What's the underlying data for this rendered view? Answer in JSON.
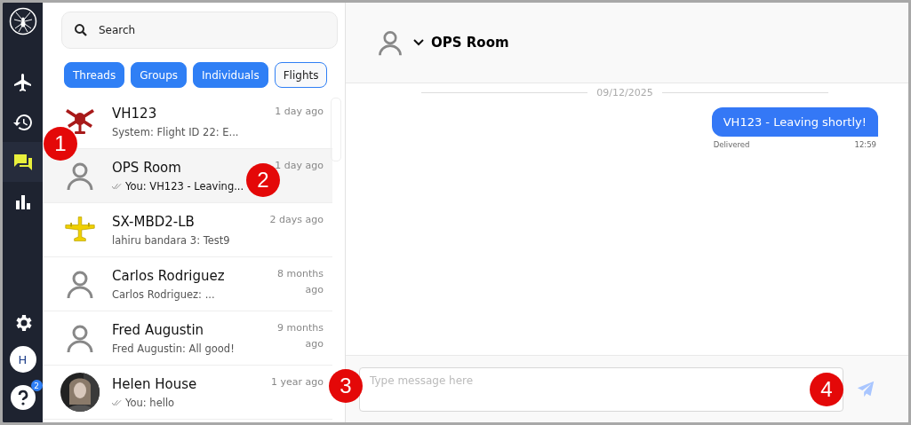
{
  "nav": [
    {
      "kind": "plane",
      "selected": false
    },
    {
      "kind": "history",
      "selected": false
    },
    {
      "kind": "chat",
      "selected": true
    },
    {
      "kind": "stats",
      "selected": false
    }
  ],
  "user": {
    "initial": "H",
    "help_badge": "2"
  },
  "search": {
    "placeholder": "Search"
  },
  "filters": [
    {
      "label": "Threads",
      "selected": true
    },
    {
      "label": "Groups",
      "selected": true
    },
    {
      "label": "Individuals",
      "selected": true
    },
    {
      "label": "Flights",
      "selected": false
    }
  ],
  "conversations": [
    {
      "kind": "helicopter",
      "name": "VH123",
      "preview": "System: Flight ID 22: E...",
      "time": "1 day ago",
      "read": false,
      "selected": false
    },
    {
      "kind": "person",
      "name": "OPS Room",
      "preview": "You: VH123 - Leaving...",
      "time": "1 day ago",
      "read": true,
      "selected": true
    },
    {
      "kind": "plane",
      "name": "SX-MBD2-LB",
      "preview": "lahiru bandara 3: Test9",
      "time": "2 days ago",
      "read": false,
      "selected": false
    },
    {
      "kind": "person",
      "name": "Carlos Rodriguez",
      "preview": "Carlos Rodriguez: ...",
      "time": "8 months ago",
      "read": false,
      "selected": false
    },
    {
      "kind": "person",
      "name": "Fred Augustin",
      "preview": "Fred Augustin: All good!",
      "time": "9 months ago",
      "read": false,
      "selected": false
    },
    {
      "kind": "picture",
      "name": "Helen House",
      "preview": "You: hello",
      "time": "1 year ago",
      "read": true,
      "selected": false
    }
  ],
  "chat": {
    "title": "OPS Room",
    "date": "09/12/2025",
    "messages": [
      {
        "text": "VH123 - Leaving shortly!",
        "status": "Delivered",
        "time": "12:59"
      }
    ],
    "input": {
      "placeholder": "Type message here"
    }
  },
  "callouts": [
    "1",
    "2",
    "3",
    "4"
  ]
}
